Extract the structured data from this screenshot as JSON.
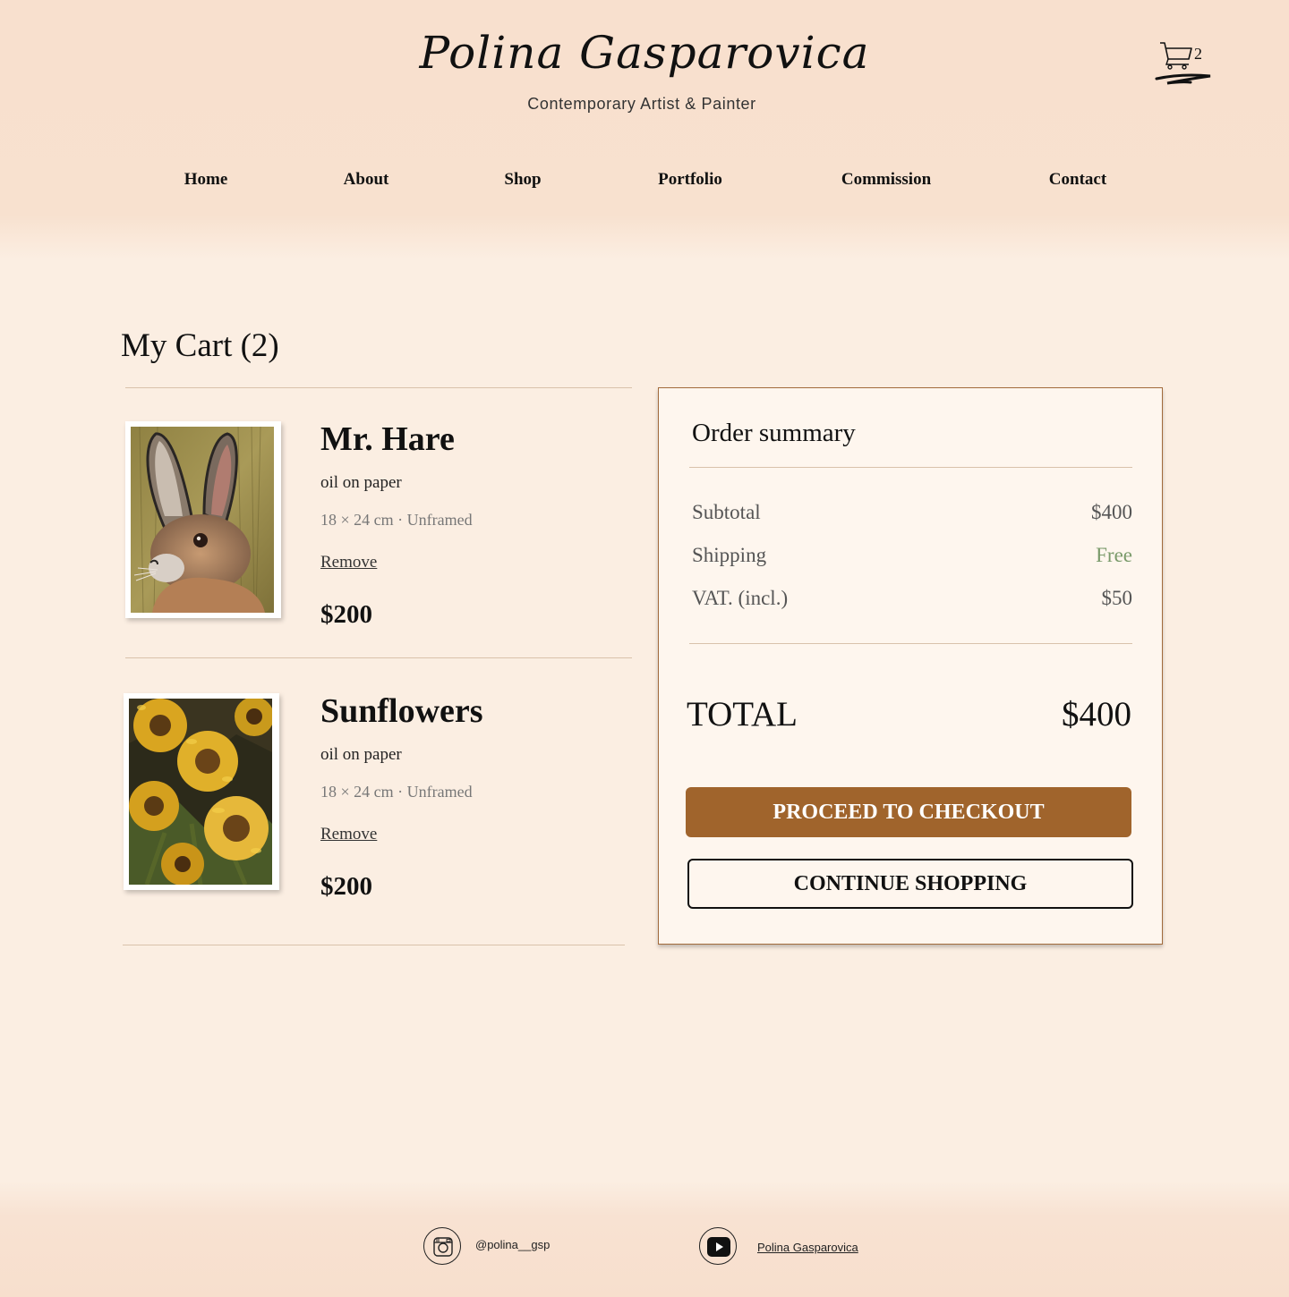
{
  "site": {
    "brand": "Polina Gasparovica",
    "tagline": "Contemporary Artist & Painter",
    "cart_count": "2"
  },
  "nav": {
    "items": [
      {
        "label": "Home"
      },
      {
        "label": "About"
      },
      {
        "label": "Shop"
      },
      {
        "label": "Portfolio"
      },
      {
        "label": "Commission"
      },
      {
        "label": "Contact"
      }
    ]
  },
  "cart": {
    "title": "My Cart (2)",
    "items": [
      {
        "name": "Mr. Hare",
        "medium": "oil on paper",
        "dimensions": "18 × 24 cm · Unframed",
        "remove_label": "Remove",
        "price": "$200",
        "image_icon": "hare-painting"
      },
      {
        "name": "Sunflowers",
        "medium": "oil on paper",
        "dimensions": "18 × 24 cm · Unframed",
        "remove_label": "Remove",
        "price": "$200",
        "image_icon": "sunflowers-painting"
      }
    ]
  },
  "summary": {
    "title": "Order summary",
    "subtotal_label": "Subtotal",
    "subtotal_value": "$400",
    "shipping_label": "Shipping",
    "shipping_value": "Free",
    "vat_label": "VAT. (incl.)",
    "vat_value": "$50",
    "total_label": "TOTAL",
    "total_value": "$400",
    "checkout_label": "PROCEED TO CHECKOUT",
    "continue_label": "CONTINUE SHOPPING"
  },
  "footer": {
    "instagram_handle": "@polina__gsp",
    "youtube_channel": "Polina Gasparovica"
  },
  "colors": {
    "accent": "#a0642c",
    "background": "#fbeee2",
    "header": "#f8e0ce",
    "free_text": "#7a9a6a"
  }
}
